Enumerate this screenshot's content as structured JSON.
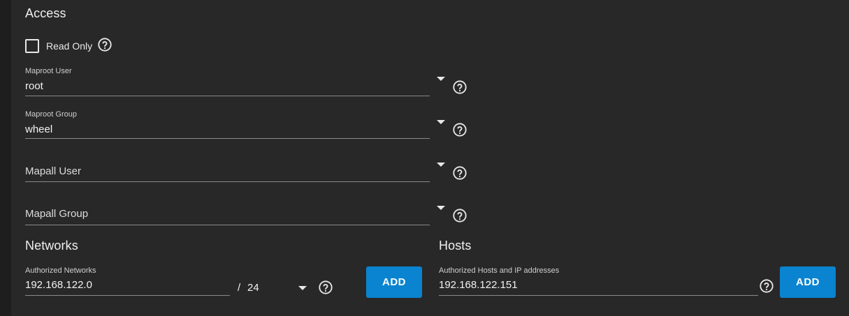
{
  "access": {
    "title": "Access",
    "read_only": {
      "label": "Read Only",
      "checked": false
    },
    "maproot_user": {
      "label": "Maproot User",
      "value": "root"
    },
    "maproot_group": {
      "label": "Maproot Group",
      "value": "wheel"
    },
    "mapall_user": {
      "placeholder": "Mapall User",
      "value": ""
    },
    "mapall_group": {
      "placeholder": "Mapall Group",
      "value": ""
    }
  },
  "networks": {
    "title": "Networks",
    "authorized_networks": {
      "label": "Authorized Networks",
      "value": "192.168.122.0"
    },
    "separator": "/",
    "netmask": "24",
    "add_label": "ADD"
  },
  "hosts": {
    "title": "Hosts",
    "authorized_hosts": {
      "label": "Authorized Hosts and IP addresses",
      "value": "192.168.122.151"
    },
    "add_label": "ADD"
  },
  "colors": {
    "background": "#1e1e1e",
    "card": "#282828",
    "accent": "#0a84d0",
    "text": "#fafafa"
  },
  "icons": {
    "help": "help-circle-icon",
    "dropdown": "caret-down-icon"
  }
}
